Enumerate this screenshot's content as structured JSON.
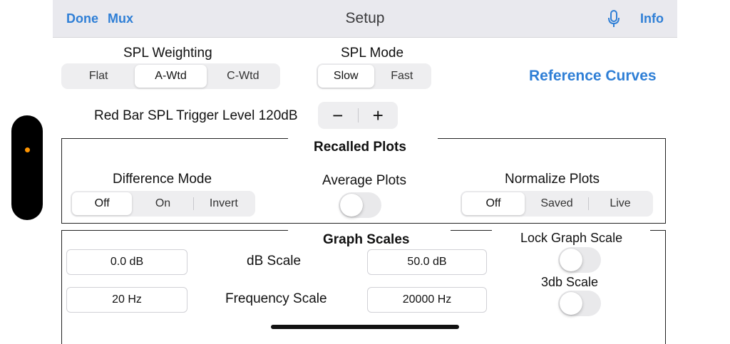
{
  "nav": {
    "done_label": "Done",
    "mux_label": "Mux",
    "title": "Setup",
    "info_label": "Info",
    "mic_icon": "microphone-icon"
  },
  "spl_weighting": {
    "label": "SPL Weighting",
    "options": [
      "Flat",
      "A-Wtd",
      "C-Wtd"
    ],
    "selected": "A-Wtd"
  },
  "spl_mode": {
    "label": "SPL Mode",
    "options": [
      "Slow",
      "Fast"
    ],
    "selected": "Slow"
  },
  "reference_curves_label": "Reference Curves",
  "trigger": {
    "label": "Red Bar SPL Trigger Level 120dB",
    "minus": "−",
    "plus": "+"
  },
  "recalled_plots": {
    "title": "Recalled Plots",
    "difference_mode": {
      "label": "Difference Mode",
      "options": [
        "Off",
        "On",
        "Invert"
      ],
      "selected": "Off"
    },
    "average_plots": {
      "label": "Average Plots",
      "on": false
    },
    "normalize_plots": {
      "label": "Normalize Plots",
      "options": [
        "Off",
        "Saved",
        "Live"
      ],
      "selected": "Off"
    }
  },
  "graph_scales": {
    "title": "Graph Scales",
    "db_scale": {
      "label": "dB Scale",
      "min_value": "0.0 dB",
      "max_value": "50.0 dB"
    },
    "frequency_scale": {
      "label": "Frequency Scale",
      "min_value": "20 Hz",
      "max_value": "20000 Hz"
    },
    "lock_graph_scale": {
      "label": "Lock Graph Scale",
      "on": false
    },
    "three_db_scale": {
      "label": "3db Scale",
      "on": false
    }
  },
  "colors": {
    "accent": "#2f7fd6",
    "indicator_dot": "#ff9500"
  }
}
